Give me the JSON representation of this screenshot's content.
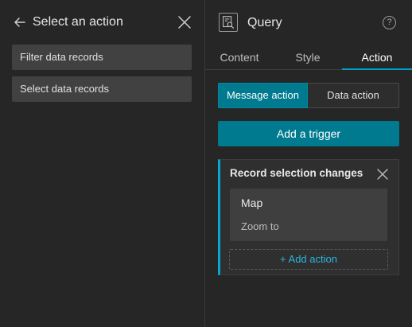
{
  "left_panel": {
    "title": "Select an action",
    "back_icon": "arrow-left-icon",
    "close_icon": "close-icon",
    "actions": [
      {
        "label": "Filter data records"
      },
      {
        "label": "Select data records"
      }
    ]
  },
  "right_panel": {
    "widget_icon": "query-widget-icon",
    "title": "Query",
    "help_icon": "help-icon",
    "help_glyph": "?",
    "tabs": [
      {
        "label": "Content",
        "active": false
      },
      {
        "label": "Style",
        "active": false
      },
      {
        "label": "Action",
        "active": true
      }
    ],
    "action_types": [
      {
        "label": "Message action",
        "selected": true
      },
      {
        "label": "Data action",
        "selected": false
      }
    ],
    "add_trigger_label": "Add a trigger",
    "trigger": {
      "title": "Record selection changes",
      "target": {
        "name": "Map",
        "action": "Zoom to"
      },
      "add_action_label": "+ Add action"
    }
  },
  "colors": {
    "accent": "#007a8f",
    "accent_highlight": "#00a0c8",
    "link": "#2bb6e0",
    "panel_bg": "#262626",
    "item_bg": "#414141"
  }
}
